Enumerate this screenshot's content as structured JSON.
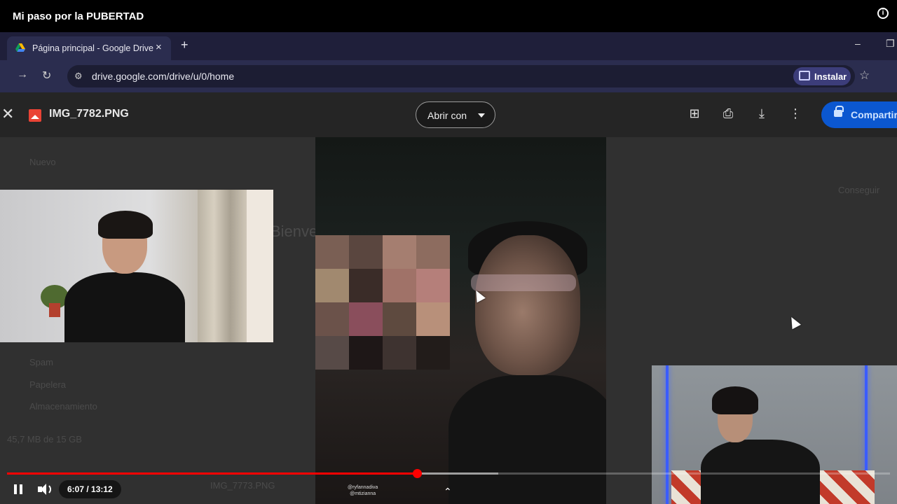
{
  "video": {
    "title": "Mi paso por la PUBERTAD",
    "info_icon": "info-icon",
    "time_current": "6:07",
    "time_total": "13:12",
    "time_display": "6:07 / 13:12",
    "progress_fraction": 0.464,
    "buffered_fraction": 0.556,
    "accent_color": "#ff0000"
  },
  "browser": {
    "tab_title": "Página principal - Google Drive",
    "tab_close": "×",
    "new_tab": "+",
    "url": "drive.google.com/drive/u/0/home",
    "install_label": "Instalar",
    "minimize": "–",
    "restore": "❐"
  },
  "viewer": {
    "file_name": "IMG_7782.PNG",
    "open_with": "Abrir con",
    "share_label": "Compartir",
    "watermark_line1": "@ryfannadiva",
    "watermark_line2": "@mtizianna",
    "icons": [
      "add-comment-icon",
      "print-icon",
      "download-icon",
      "more-vert-icon"
    ],
    "share_color": "#0b57d0"
  },
  "drive_background": {
    "nuevo": "Nuevo",
    "bienvenido": "Bienve",
    "spam": "Spam",
    "papelera": "Papelera",
    "almacenamiento": "Almacenamiento",
    "storage_used": "45,7 MB de 15 GB",
    "file_row": "IMG_7773.PNG",
    "storage_link": "Conseguir"
  }
}
